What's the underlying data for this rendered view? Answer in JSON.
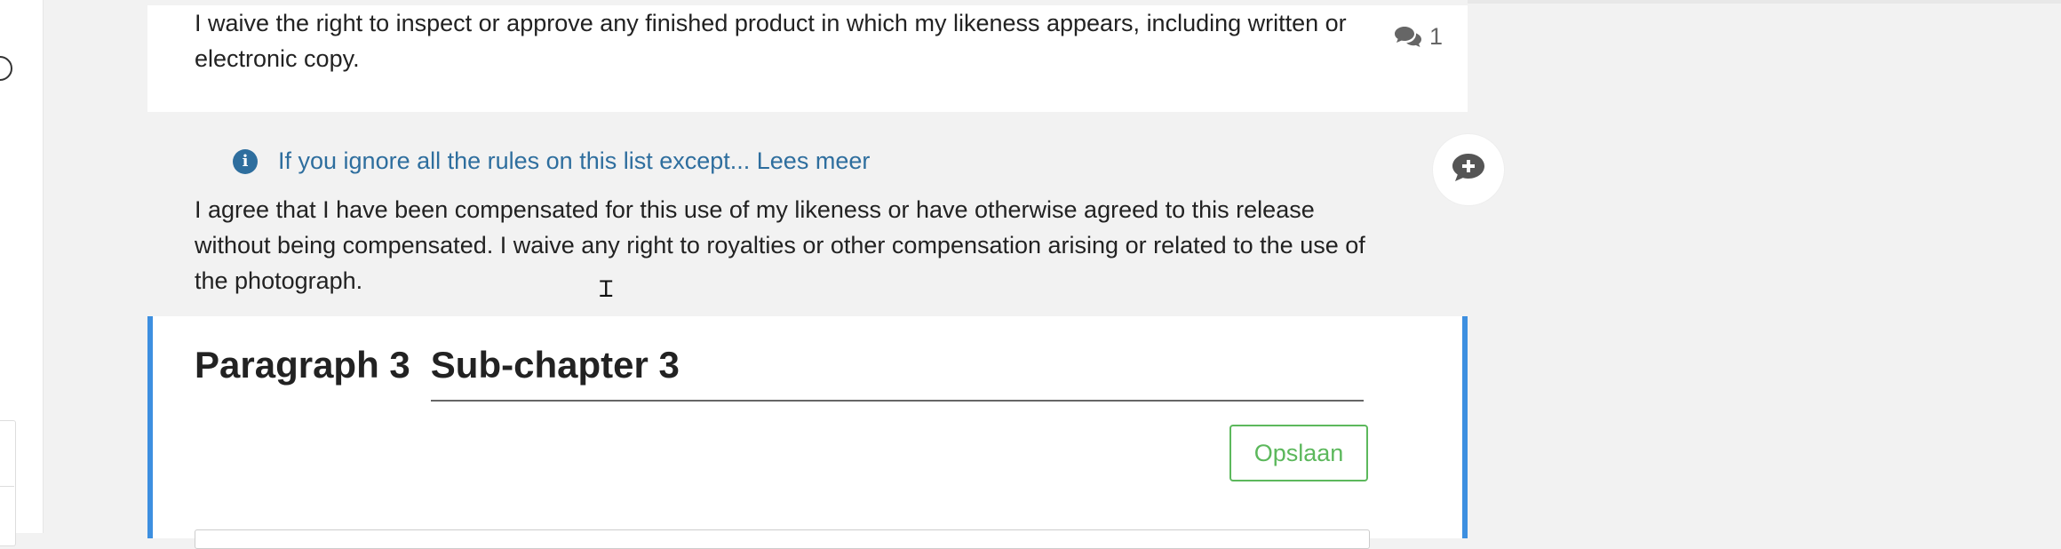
{
  "block1": {
    "text": "I waive the right to inspect or approve any finished product in which my likeness appears, including written or electronic copy.",
    "comment_count": "1"
  },
  "block2": {
    "info_text": "If you ignore all the rules on this list except... Lees meer",
    "text": "I agree that I have been compensated for this use of my likeness or have otherwise agreed to this release without being compensated. I waive any right to royalties or other compensation arising or related to the use of the photograph."
  },
  "block3": {
    "paragraph_label": "Paragraph 3",
    "title_value": "Sub-chapter 3",
    "save_label": "Opslaan"
  },
  "colors": {
    "accent_blue": "#3d8fe0",
    "link_blue": "#2e6e9e",
    "save_green": "#5cb85c"
  },
  "icons": [
    "comments-icon",
    "info-icon",
    "add-comment-icon",
    "text-cursor-icon"
  ]
}
